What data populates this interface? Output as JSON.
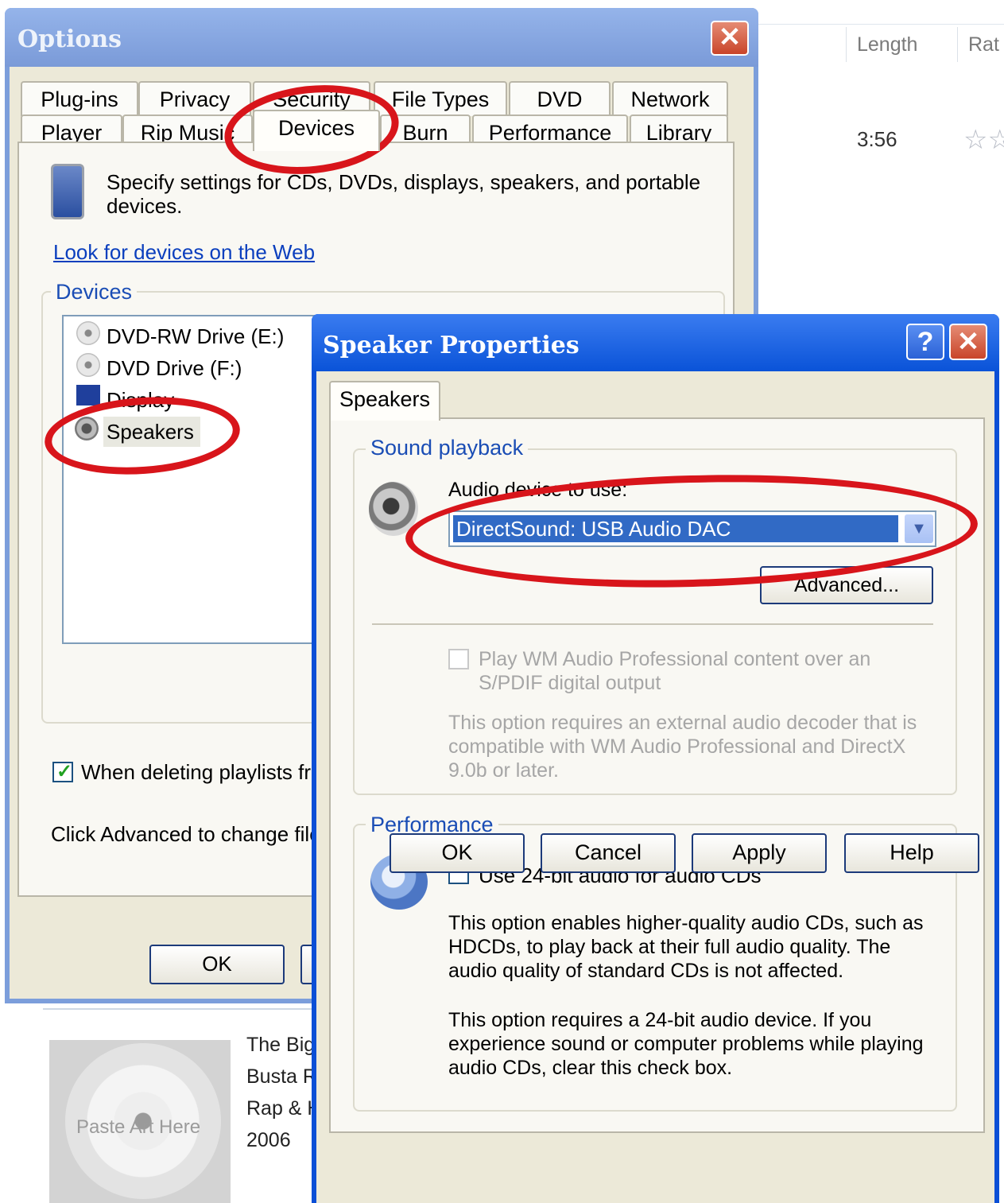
{
  "background": {
    "columns": [
      "Length",
      "Rat"
    ],
    "track_length": "3:56",
    "album_art_placeholder": "Paste Art Here",
    "album_info": [
      "The Big",
      "Busta R",
      "Rap & H",
      "2006"
    ]
  },
  "options": {
    "title": "Options",
    "close_glyph": "✕",
    "tabs_row1": [
      "Plug-ins",
      "Privacy",
      "Security",
      "File Types",
      "DVD",
      "Network"
    ],
    "tabs_row2": [
      "Player",
      "Rip Music",
      "Devices",
      "Burn",
      "Performance",
      "Library"
    ],
    "description": "Specify settings for CDs, DVDs, displays, speakers, and portable devices.",
    "web_link": "Look for devices on the Web",
    "devices_group_label": "Devices",
    "devices": [
      "DVD-RW Drive (E:)",
      "DVD Drive (F:)",
      "Display",
      "Speakers"
    ],
    "delete_checkbox_label": "When deleting playlists fro",
    "advanced_note": "Click Advanced to change file",
    "ok_label": "OK"
  },
  "speaker_properties": {
    "title": "Speaker Properties",
    "help_glyph": "?",
    "close_glyph": "✕",
    "tab": "Speakers",
    "sound_playback_label": "Sound playback",
    "audio_device_label": "Audio device to use:",
    "audio_device_value": "DirectSound: USB Audio DAC",
    "advanced_button": "Advanced...",
    "spdif_checkbox_label": "Play WM Audio Professional content over an S/PDIF digital output",
    "spdif_note": "This option requires an external audio decoder that is compatible with WM Audio Professional and DirectX 9.0b or later.",
    "performance_label": "Performance",
    "bit24_checkbox_label": "Use 24-bit audio for audio CDs",
    "bit24_desc1": "This option enables higher-quality audio CDs, such as HDCDs, to play back at their full audio quality. The audio quality of standard CDs is not affected.",
    "bit24_desc2": "This option requires a 24-bit audio device. If you experience sound or computer problems while playing audio CDs, clear this check box.",
    "buttons": {
      "ok": "OK",
      "cancel": "Cancel",
      "apply": "Apply",
      "help": "Help"
    }
  },
  "colors": {
    "annotation_red": "#d8151b",
    "xp_blue_title": "#0a53d8",
    "selection_blue": "#316ac5"
  }
}
